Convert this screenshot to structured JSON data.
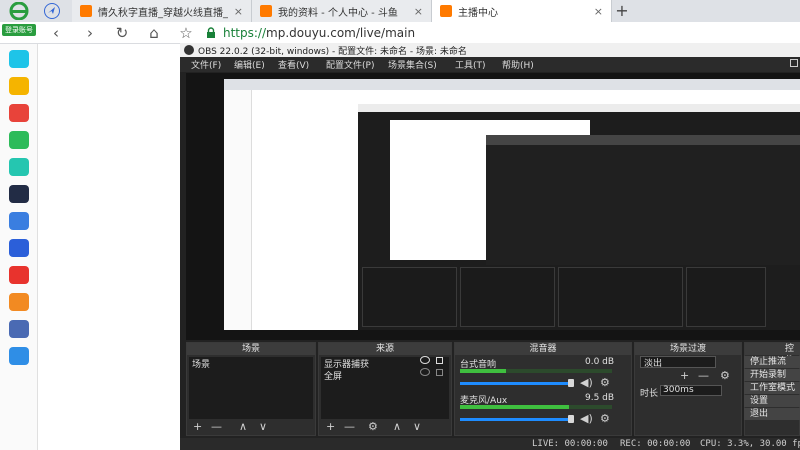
{
  "browser": {
    "tabs": [
      {
        "title": "情久秋字直播_穿越火线直播_斗...",
        "close": "×",
        "active": false,
        "color": "#ff7a00"
      },
      {
        "title": "我的资料 - 个人中心 - 斗鱼",
        "close": "×",
        "active": false,
        "color": "#ff7a00"
      },
      {
        "title": "主播中心",
        "close": "×",
        "active": true,
        "color": "#ff7a00"
      }
    ],
    "new_tab": "+",
    "nav": {
      "back": "‹",
      "forward": "›",
      "reload": "↻",
      "home": "⌂",
      "star": "☆"
    },
    "url_scheme": "https://",
    "url_rest": "mp.douyu.com/live/main"
  },
  "sidebar": {
    "login_label": "登录账号",
    "icons": [
      {
        "name": "sidebar-app-1",
        "color": "#1ec4e8"
      },
      {
        "name": "sidebar-app-2",
        "color": "#f5b400"
      },
      {
        "name": "sidebar-app-3",
        "color": "#e8433a"
      },
      {
        "name": "sidebar-app-4",
        "color": "#2dbb5a"
      },
      {
        "name": "sidebar-app-5",
        "color": "#25c6b0"
      },
      {
        "name": "sidebar-app-6",
        "color": "#222c45"
      },
      {
        "name": "sidebar-app-7",
        "color": "#3a7ee0"
      },
      {
        "name": "sidebar-app-8",
        "color": "#2b5fd9"
      },
      {
        "name": "sidebar-app-9",
        "color": "#e8332d"
      },
      {
        "name": "sidebar-app-10",
        "color": "#f28a22"
      },
      {
        "name": "sidebar-app-11",
        "color": "#4a6ab3"
      },
      {
        "name": "sidebar-app-12",
        "color": "#2f8ee6"
      }
    ]
  },
  "obs": {
    "title": "OBS 22.0.2 (32-bit, windows) - 配置文件: 未命名 - 场景: 未命名",
    "menu": [
      "文件(F)",
      "编辑(E)",
      "查看(V)",
      "配置文件(P)",
      "场景集合(S)",
      "工具(T)",
      "帮助(H)"
    ],
    "scenes": {
      "header": "场景",
      "items": [
        "场景"
      ]
    },
    "sources": {
      "header": "来源",
      "items": [
        "显示器捕获",
        "全屏"
      ]
    },
    "mixer": {
      "header": "混音器",
      "channels": [
        {
          "name": "台式音响",
          "db": "0.0 dB",
          "level": 0.3
        },
        {
          "name": "麦克风/Aux",
          "db": "9.5 dB",
          "level": 0.72
        }
      ]
    },
    "transitions": {
      "header": "场景过渡",
      "selected": "淡出",
      "duration_label": "时长",
      "duration_value": "300ms"
    },
    "controls": {
      "header": "控件",
      "buttons": [
        "停止推流",
        "开始录制",
        "工作室模式",
        "设置",
        "退出"
      ]
    },
    "status": {
      "live": "LIVE: 00:00:00",
      "rec": "REC: 00:00:00",
      "cpu": "CPU: 3.3%, 30.00 fps"
    },
    "tools": {
      "add": "+",
      "remove": "—",
      "gear": "⚙",
      "up": "∧",
      "down": "∨",
      "speaker": "🔊",
      "eye": "👁",
      "lock": "🔒"
    }
  }
}
